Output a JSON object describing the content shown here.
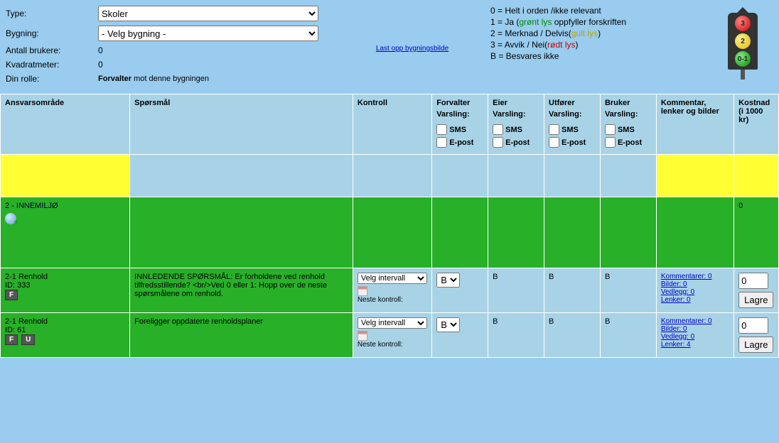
{
  "form": {
    "type_label": "Type:",
    "type_value": "Skoler",
    "bygning_label": "Bygning:",
    "bygning_value": "- Velg bygning -",
    "antall_label": "Antall brukere:",
    "antall_value": "0",
    "kvm_label": "Kvadratmeter:",
    "kvm_value": "0",
    "rolle_label": "Din rolle:",
    "rolle_bold": "Forvalter",
    "rolle_rest": " mot denne bygningen"
  },
  "upload_link": "Last opp bygningsbilde",
  "legend": {
    "l0": "0 = Helt i orden /ikke relevant",
    "l1a": "1 = Ja (",
    "l1b": "grønt lys",
    "l1c": " oppfyller forskriften",
    "l2a": "2 = Merknad / Delvis(",
    "l2b": "gult lys",
    "l2c": ")",
    "l3a": "3 = Avvik / Nei(",
    "l3b": "rødt lys",
    "l3c": ")",
    "lB": "B = Besvares ikke",
    "t3": "3",
    "t2": "2",
    "t01": "0-1"
  },
  "headers": {
    "ansvar": "Ansvarsområde",
    "spor": "Spørsmål",
    "kontroll": "Kontroll",
    "forvalter": "Forvalter",
    "eier": "Eier",
    "utforer": "Utfører",
    "bruker": "Bruker",
    "varsling": "Varsling:",
    "sms": "SMS",
    "epost": "E-post",
    "kommentar": "Kommentar, lenker og bilder",
    "kostnad": "Kostnad (i 1000 kr)"
  },
  "section": {
    "title": "2 - INNEMILJØ",
    "cost": "0"
  },
  "kontroll": {
    "select_default": "Velg intervall",
    "neste": "Neste kontroll:"
  },
  "row1": {
    "title": "2-1 Renhold",
    "id": "ID: 333",
    "badge_f": "F",
    "question": "INNLEDENDE SPØRSMÅL: Er forholdene ved renhold tilfredsstillende? <br/>Ved 0 eller 1: Hopp over de neste spørsmålene om renhold.",
    "answer": "B",
    "eier": "B",
    "utforer": "B",
    "bruker": "B",
    "kommentarer": "Kommentarer: 0",
    "bilder": "Bilder: 0",
    "vedlegg": "Vedlegg: 0",
    "lenker": "Lenker: 0",
    "cost": "0",
    "save": "Lagre"
  },
  "row2": {
    "title": "2-1 Renhold",
    "id": "ID: 61",
    "badge_f": "F",
    "badge_u": "U",
    "question": "Foreligger oppdaterte renholdsplaner",
    "answer": "B",
    "eier": "B",
    "utforer": "B",
    "bruker": "B",
    "kommentarer": "Kommentarer: 0",
    "bilder": "Bilder: 0",
    "vedlegg": "Vedlegg: 0",
    "lenker": "Lenker: 4",
    "cost": "0",
    "save": "Lagre"
  }
}
